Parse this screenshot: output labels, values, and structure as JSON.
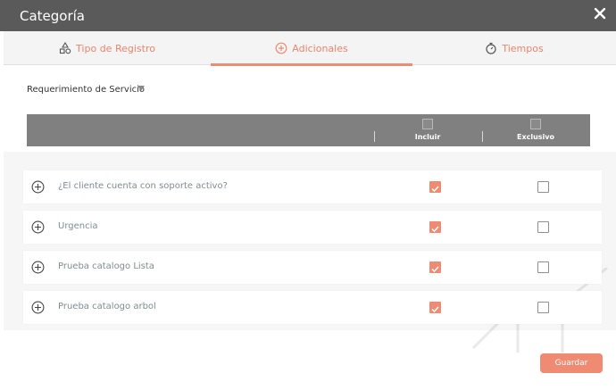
{
  "window": {
    "title": "Categoría",
    "close_icon": "close-icon"
  },
  "tabs": [
    {
      "label": "Tipo de Registro",
      "icon": "shapes-icon",
      "active": false
    },
    {
      "label": "Adicionales",
      "icon": "plus-circle-icon",
      "active": true
    },
    {
      "label": "Tiempos",
      "icon": "stopwatch-icon",
      "active": false
    }
  ],
  "filter": {
    "selected": "Requerimiento de Servicio"
  },
  "table": {
    "columns": {
      "include": "Incluir",
      "exclusive": "Exclusivo"
    },
    "rows": [
      {
        "label": "¿El cliente cuenta con soporte activo?",
        "include": true,
        "exclusive": false
      },
      {
        "label": "Urgencia",
        "include": true,
        "exclusive": false
      },
      {
        "label": "Prueba catalogo Lista",
        "include": true,
        "exclusive": false
      },
      {
        "label": "Prueba catalogo arbol",
        "include": true,
        "exclusive": false
      }
    ]
  },
  "actions": {
    "save": "Guardar"
  },
  "colors": {
    "accent": "#ef8a73",
    "titlebar": "#5a5a5a",
    "header": "#808080"
  }
}
